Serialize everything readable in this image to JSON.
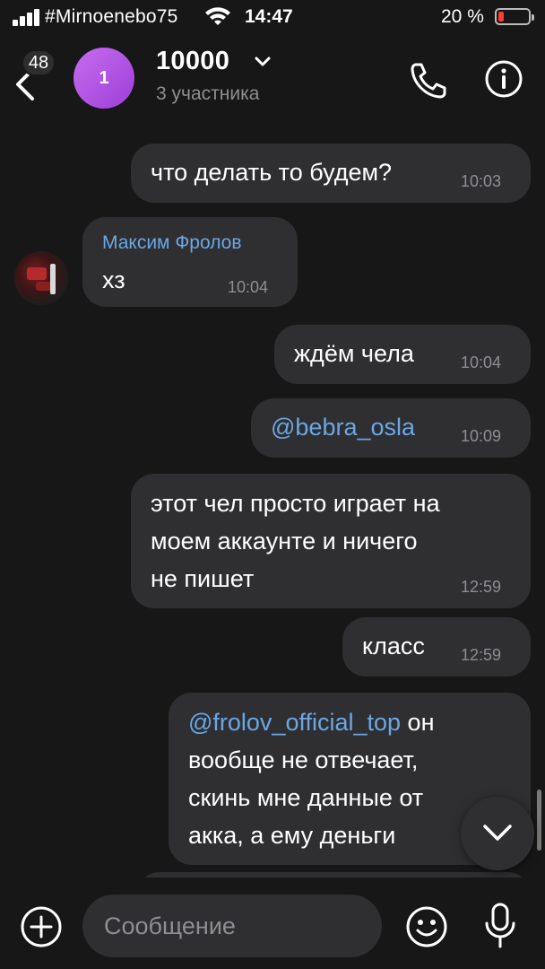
{
  "status_bar": {
    "carrier": "#Mirnoenebo75",
    "time": "14:47",
    "battery_percent": "20 %",
    "battery_level": 0.2,
    "battery_color": "#ff3b30"
  },
  "header": {
    "back_badge": "48",
    "avatar_letter": "1",
    "avatar_color": "#b356e6",
    "title": "10000",
    "subtitle": "3 участника",
    "icons": [
      "back-icon",
      "chevron-down-icon",
      "phone-icon",
      "info-icon"
    ]
  },
  "messages": [
    {
      "text": "что делать то будем?",
      "time": "10:03",
      "outgoing": true
    },
    {
      "sender": "Максим Фролов",
      "text": "хз",
      "time": "10:04",
      "outgoing": false
    },
    {
      "text": "ждём чела",
      "time": "10:04",
      "outgoing": true
    },
    {
      "mention": "@bebra_osla",
      "time": "10:09",
      "outgoing": true
    },
    {
      "lines": [
        "этот чел просто играет на",
        "моем аккаунте и ничего",
        "не пишет"
      ],
      "time": "12:59",
      "outgoing": true
    },
    {
      "text": "класс",
      "time": "12:59",
      "outgoing": true
    },
    {
      "mention": "@frolov_official_top",
      "lines": [
        " он",
        "вообще не отвечает,",
        "скинь мне данные от",
        "акка, а ему деньги"
      ],
      "outgoing": true
    }
  ],
  "composer": {
    "placeholder": "Сообщение",
    "icons": [
      "plus-icon",
      "emoji-icon",
      "microphone-icon"
    ]
  },
  "accent_color": "#6aa7e6"
}
